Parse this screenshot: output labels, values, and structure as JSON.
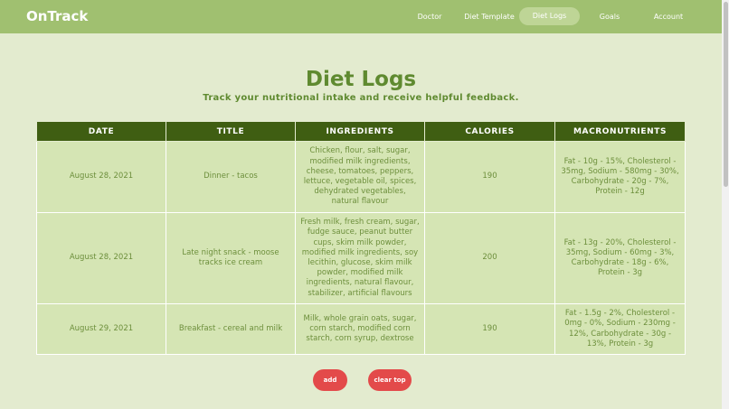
{
  "nav": {
    "logo": "OnTrack",
    "items": [
      {
        "label": "Doctor"
      },
      {
        "label": "Diet Template"
      },
      {
        "label": "Diet Logs"
      },
      {
        "label": "Goals"
      },
      {
        "label": "Account"
      }
    ],
    "active": "Diet Logs"
  },
  "page": {
    "title": "Diet Logs",
    "subtitle": "Track your nutritional intake and receive helpful feedback."
  },
  "table": {
    "headers": [
      "DATE",
      "TITLE",
      "INGREDIENTS",
      "CALORIES",
      "MACRONUTRIENTS"
    ],
    "rows": [
      {
        "date": "August 28, 2021",
        "title": "Dinner - tacos",
        "ingredients": "Chicken, flour, salt, sugar, modified milk ingredients, cheese, tomatoes, peppers, lettuce, vegetable oil, spices, dehydrated vegetables, natural flavour",
        "calories": "190",
        "macros": "Fat - 10g - 15%, Cholesterol - 35mg, Sodium - 580mg - 30%, Carbohydrate - 20g - 7%, Protein - 12g"
      },
      {
        "date": "August 28, 2021",
        "title": "Late night snack - moose tracks ice cream",
        "ingredients": "Fresh milk, fresh cream, sugar, fudge sauce, peanut butter cups, skim milk powder, modified milk ingredients, soy lecithin, glucose, skim milk powder, modified milk ingredients, natural flavour, stabilizer, artificial flavours",
        "calories": "200",
        "macros": "Fat - 13g - 20%, Cholesterol - 35mg, Sodium - 60mg - 3%, Carbohydrate - 18g - 6%, Protein - 3g"
      },
      {
        "date": "August 29, 2021",
        "title": "Breakfast - cereal and milk",
        "ingredients": "Milk, whole grain oats, sugar, corn starch, modified corn starch, corn syrup, dextrose",
        "calories": "190",
        "macros": "Fat - 1.5g - 2%, Cholesterol - 0mg - 0%, Sodium - 230mg - 12%, Carbohydrate - 30g - 13%, Protein - 3g"
      }
    ]
  },
  "buttons": {
    "add": "add",
    "clear_top": "clear top"
  },
  "colors": {
    "navbar": "#a0c070",
    "background": "#e3ebcf",
    "header": "#3f5e12",
    "cell": "#d5e5b4",
    "accent_text": "#5f8a30",
    "button": "#e34a4a"
  }
}
